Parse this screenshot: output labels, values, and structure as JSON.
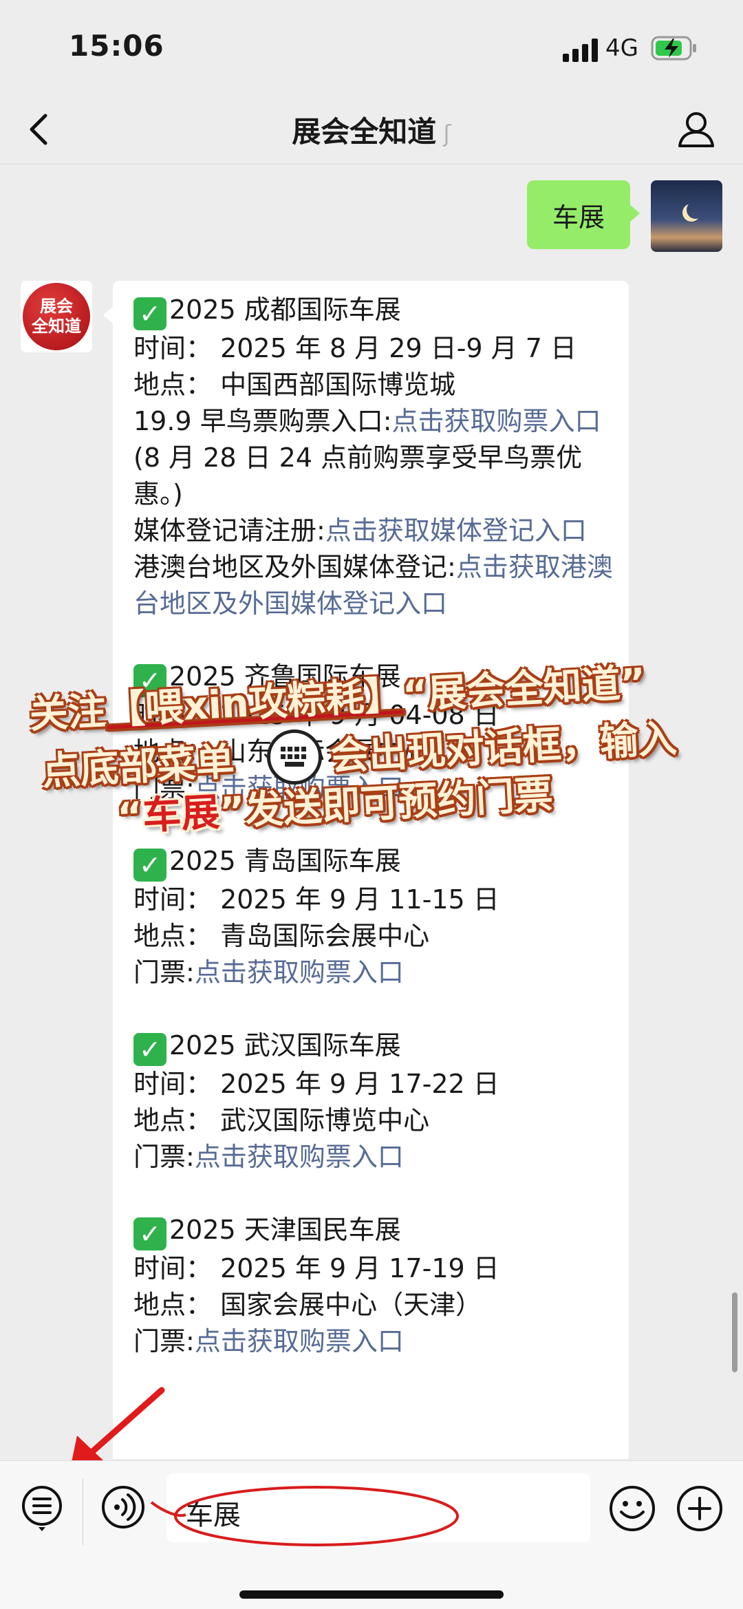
{
  "status": {
    "time": "15:06",
    "network": "4G"
  },
  "nav": {
    "title": "展会全知道"
  },
  "my_message": {
    "text": "车展"
  },
  "bot": {
    "avatar_text_1": "展会",
    "avatar_text_2": "全知道",
    "events": [
      {
        "title": "2025 成都国际车展",
        "time": "时间： 2025 年 8 月 29 日-9 月 7 日",
        "place": "地点： 中国西部国际博览城",
        "ticket_label": "19.9 早鸟票购票入口:",
        "ticket_link": "点击获取购票入口",
        "ticket_note": "(8 月 28 日 24 点前购票享受早鸟票优惠。)",
        "extra_label_1": "媒体登记请注册:",
        "extra_link_1": "点击获取媒体登记入口",
        "extra_label_2": "港澳台地区及外国媒体登记:",
        "extra_link_2": "点击获取港澳台地区及外国媒体登记入口"
      },
      {
        "title": "2025 齐鲁国际车展",
        "time": "时间： 2025 年 9 月 04-08 日",
        "place": "地点： 山东国际会展中心",
        "ticket_label": "门票:",
        "ticket_link": "点击获取购票入口"
      },
      {
        "title": "2025 青岛国际车展",
        "time": "时间： 2025 年 9 月 11-15 日",
        "place": "地点： 青岛国际会展中心",
        "ticket_label": "门票:",
        "ticket_link": "点击获取购票入口"
      },
      {
        "title": "2025 武汉国际车展",
        "time": "时间： 2025 年 9 月 17-22 日",
        "place": "地点： 武汉国际博览中心",
        "ticket_label": "门票:",
        "ticket_link": "点击获取购票入口"
      },
      {
        "title": "2025 天津国民车展",
        "time": "时间： 2025 年 9 月 17-19 日",
        "place": "地点： 国家会展中心（天津）",
        "ticket_label": "门票:",
        "ticket_link": "点击获取购票入口"
      }
    ]
  },
  "overlay": {
    "line1_a": "关注",
    "line1_b": "【喂xin攻粽耗】",
    "line1_c": "“展会全知道”",
    "line2_a": "点底部菜单",
    "line2_b": "会出现对话框，输入",
    "line3_a": "“",
    "line3_b": "车展",
    "line3_c": "”发送即可预约门票"
  },
  "input": {
    "value": "车展"
  },
  "colors": {
    "link": "#576b95",
    "my_bubble": "#95ec69",
    "check": "#2fb24c"
  }
}
